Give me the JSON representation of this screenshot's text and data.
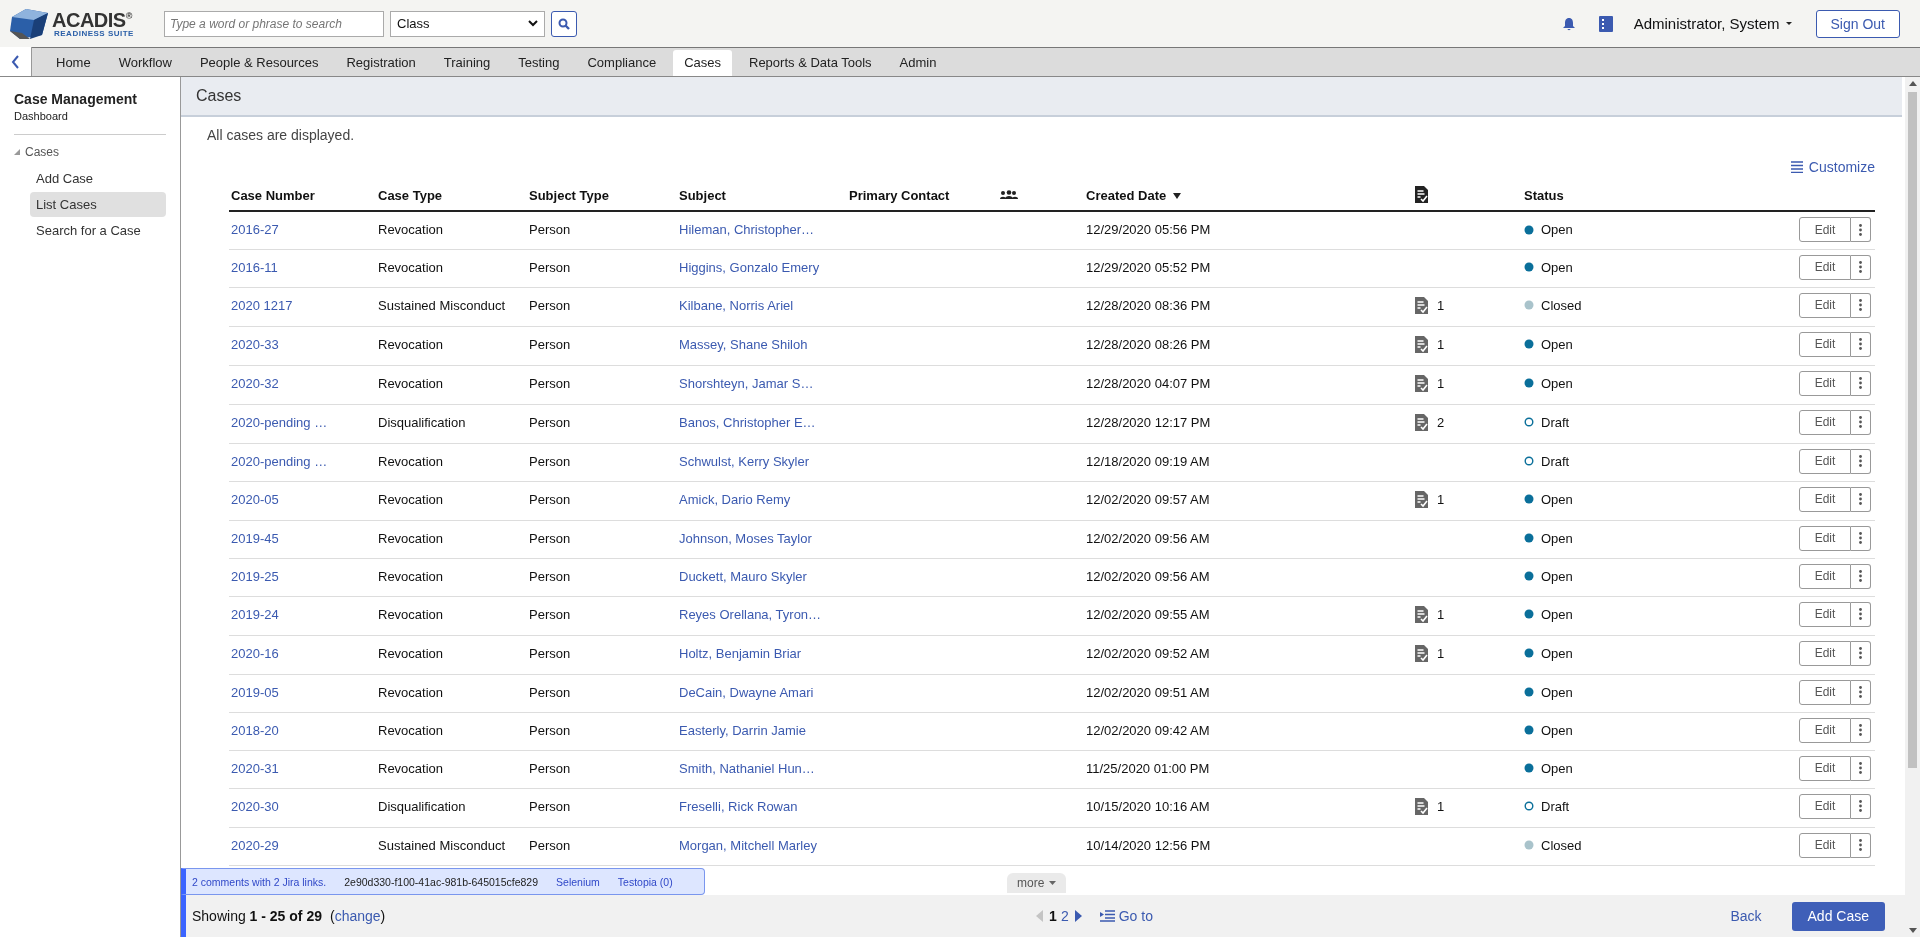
{
  "header": {
    "logo": {
      "name": "ACADIS$^{®}$",
      "tagline": "READINESS SUITE"
    },
    "search": {
      "placeholder": "Type a word or phrase to search"
    },
    "category": {
      "value": "Class"
    },
    "user": {
      "name": "Administrator, System"
    },
    "sign_out": "Sign Out"
  },
  "nav": {
    "tabs": [
      {
        "label": "Home",
        "selected": false
      },
      {
        "label": "Workflow",
        "selected": false
      },
      {
        "label": "People & Resources",
        "selected": false
      },
      {
        "label": "Registration",
        "selected": false
      },
      {
        "label": "Training",
        "selected": false
      },
      {
        "label": "Testing",
        "selected": false
      },
      {
        "label": "Compliance",
        "selected": false
      },
      {
        "label": "Cases",
        "selected": true
      },
      {
        "label": "Reports & Data Tools",
        "selected": false
      },
      {
        "label": "Admin",
        "selected": false
      }
    ]
  },
  "sidebar": {
    "title": "Case Management",
    "subtitle": "Dashboard",
    "tree": [
      {
        "label": "Cases",
        "expanded": true,
        "children": [
          {
            "label": "Add Case",
            "selected": false
          },
          {
            "label": "List Cases",
            "selected": true
          },
          {
            "label": "Search for a Case",
            "selected": false
          }
        ]
      }
    ]
  },
  "page": {
    "title": "Cases",
    "notice": "All cases are displayed.",
    "customize": "Customize"
  },
  "table": {
    "columns": [
      {
        "kind": "text",
        "label": "Case Number"
      },
      {
        "kind": "text",
        "label": "Case Type"
      },
      {
        "kind": "text",
        "label": "Subject Type"
      },
      {
        "kind": "text",
        "label": "Subject"
      },
      {
        "kind": "text",
        "label": "Primary Contact"
      },
      {
        "kind": "people"
      },
      {
        "kind": "text",
        "label": "Created Date",
        "sorted": true
      },
      {
        "kind": "documents"
      },
      {
        "kind": "text",
        "label": "Status"
      }
    ],
    "rows": [
      {
        "case_number": "2016-27",
        "case_type": "Revocation",
        "subject_type": "Person",
        "subject": "Hileman, Christopher…",
        "created_date": "12/29/2020 05:56 PM",
        "status": "Open",
        "color": "#0a6f9a",
        "filled": true,
        "action": "Edit"
      },
      {
        "case_number": "2016-11",
        "case_type": "Revocation",
        "subject_type": "Person",
        "subject": "Higgins, Gonzalo Emery",
        "created_date": "12/29/2020 05:52 PM",
        "status": "Open",
        "color": "#0a6f9a",
        "filled": true,
        "action": "Edit"
      },
      {
        "case_number": "2020 1217",
        "case_type": "Sustained Misconduct",
        "subject_type": "Person",
        "subject": "Kilbane, Norris Ariel",
        "created_date": "12/28/2020 08:36 PM",
        "documents": "1",
        "status": "Closed",
        "color": "#a9c3cb",
        "filled": true,
        "action": "Edit"
      },
      {
        "case_number": "2020-33",
        "case_type": "Revocation",
        "subject_type": "Person",
        "subject": "Massey, Shane Shiloh",
        "created_date": "12/28/2020 08:26 PM",
        "documents": "1",
        "status": "Open",
        "color": "#0a6f9a",
        "filled": true,
        "action": "Edit"
      },
      {
        "case_number": "2020-32",
        "case_type": "Revocation",
        "subject_type": "Person",
        "subject": "Shorshteyn, Jamar S…",
        "created_date": "12/28/2020 04:07 PM",
        "documents": "1",
        "status": "Open",
        "color": "#0a6f9a",
        "filled": true,
        "action": "Edit"
      },
      {
        "case_number": "2020-pending …",
        "case_type": "Disqualification",
        "subject_type": "Person",
        "subject": "Banos, Christopher E…",
        "created_date": "12/28/2020 12:17 PM",
        "documents": "2",
        "status": "Draft",
        "color": "#0a6f9a",
        "filled": false,
        "action": "Edit"
      },
      {
        "case_number": "2020-pending …",
        "case_type": "Revocation",
        "subject_type": "Person",
        "subject": "Schwulst, Kerry Skyler",
        "created_date": "12/18/2020 09:19 AM",
        "status": "Draft",
        "color": "#0a6f9a",
        "filled": false,
        "action": "Edit"
      },
      {
        "case_number": "2020-05",
        "case_type": "Revocation",
        "subject_type": "Person",
        "subject": "Amick, Dario Remy",
        "created_date": "12/02/2020 09:57 AM",
        "documents": "1",
        "status": "Open",
        "color": "#0a6f9a",
        "filled": true,
        "action": "Edit"
      },
      {
        "case_number": "2019-45",
        "case_type": "Revocation",
        "subject_type": "Person",
        "subject": "Johnson, Moses Taylor",
        "created_date": "12/02/2020 09:56 AM",
        "status": "Open",
        "color": "#0a6f9a",
        "filled": true,
        "action": "Edit"
      },
      {
        "case_number": "2019-25",
        "case_type": "Revocation",
        "subject_type": "Person",
        "subject": "Duckett, Mauro Skyler",
        "created_date": "12/02/2020 09:56 AM",
        "status": "Open",
        "color": "#0a6f9a",
        "filled": true,
        "action": "Edit"
      },
      {
        "case_number": "2019-24",
        "case_type": "Revocation",
        "subject_type": "Person",
        "subject": "Reyes Orellana, Tyron…",
        "created_date": "12/02/2020 09:55 AM",
        "documents": "1",
        "status": "Open",
        "color": "#0a6f9a",
        "filled": true,
        "action": "Edit"
      },
      {
        "case_number": "2020-16",
        "case_type": "Revocation",
        "subject_type": "Person",
        "subject": "Holtz, Benjamin Briar",
        "created_date": "12/02/2020 09:52 AM",
        "documents": "1",
        "status": "Open",
        "color": "#0a6f9a",
        "filled": true,
        "action": "Edit"
      },
      {
        "case_number": "2019-05",
        "case_type": "Revocation",
        "subject_type": "Person",
        "subject": "DeCain, Dwayne Amari",
        "created_date": "12/02/2020 09:51 AM",
        "status": "Open",
        "color": "#0a6f9a",
        "filled": true,
        "action": "Edit"
      },
      {
        "case_number": "2018-20",
        "case_type": "Revocation",
        "subject_type": "Person",
        "subject": "Easterly, Darrin Jamie",
        "created_date": "12/02/2020 09:42 AM",
        "status": "Open",
        "color": "#0a6f9a",
        "filled": true,
        "action": "Edit"
      },
      {
        "case_number": "2020-31",
        "case_type": "Revocation",
        "subject_type": "Person",
        "subject": "Smith, Nathaniel Hun…",
        "created_date": "11/25/2020 01:00 PM",
        "status": "Open",
        "color": "#0a6f9a",
        "filled": true,
        "action": "Edit"
      },
      {
        "case_number": "2020-30",
        "case_type": "Disqualification",
        "subject_type": "Person",
        "subject": "Freselli, Rick Rowan",
        "created_date": "10/15/2020 10:16 AM",
        "documents": "1",
        "status": "Draft",
        "color": "#0a6f9a",
        "filled": false,
        "action": "Edit"
      },
      {
        "case_number": "2020-29",
        "case_type": "Sustained Misconduct",
        "subject_type": "Person",
        "subject": "Morgan, Mitchell Marley",
        "created_date": "10/14/2020 12:56 PM",
        "status": "Closed",
        "color": "#a9c3cb",
        "filled": true,
        "action": "Edit"
      }
    ]
  },
  "more": "more",
  "debug_bar": {
    "comments": "2 comments with 2 Jira links.",
    "guid": "2e90d330-f100-41ac-981b-645015cfe829",
    "selenium": "Selenium",
    "testopia": "Testopia (0)"
  },
  "footer": {
    "showing": "Showing **1 - 25 of 29**",
    "change": {
      "before": "(",
      "link": "change",
      "after": ")"
    },
    "pager": {
      "prev_disabled": true,
      "pages": [
        {
          "label": "1",
          "selected": true
        },
        {
          "label": "2",
          "selected": false
        }
      ],
      "goto": "Go to"
    },
    "back": "Back",
    "add": "Add Case"
  }
}
